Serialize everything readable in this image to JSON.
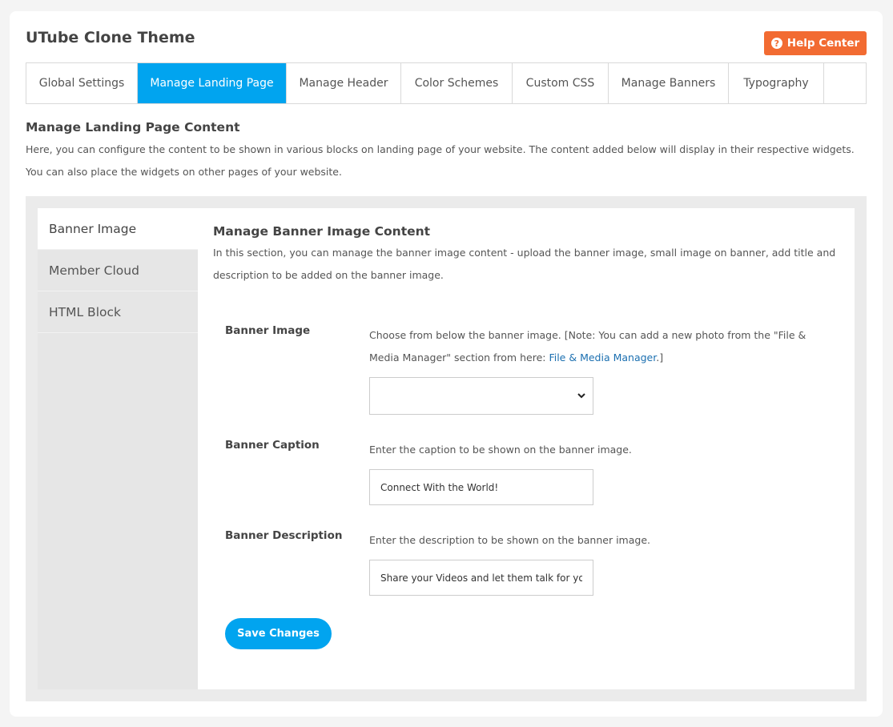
{
  "header": {
    "title": "UTube Clone Theme",
    "help_label": "Help Center",
    "help_icon": "question-circle-icon"
  },
  "tabs": [
    {
      "label": "Global Settings",
      "active": false
    },
    {
      "label": "Manage Landing Page",
      "active": true
    },
    {
      "label": "Manage Header",
      "active": false
    },
    {
      "label": "Color Schemes",
      "active": false
    },
    {
      "label": "Custom CSS",
      "active": false
    },
    {
      "label": "Manage Banners",
      "active": false
    },
    {
      "label": "Typography",
      "active": false
    }
  ],
  "section": {
    "title": "Manage Landing Page Content",
    "description": "Here, you can configure the content to be shown in various blocks on landing page of your website. The content added below will display in their respective widgets. You can also place the widgets on other pages of your website."
  },
  "sidebar": {
    "items": [
      {
        "label": "Banner Image",
        "active": true
      },
      {
        "label": "Member Cloud",
        "active": false
      },
      {
        "label": "HTML Block",
        "active": false
      }
    ]
  },
  "content": {
    "title": "Manage Banner Image Content",
    "description": "In this section, you can manage the banner image content - upload the banner image, small image on banner, add title and description to be added on the banner image.",
    "banner_image": {
      "label": "Banner Image",
      "help_prefix": "Choose from below the banner image. [Note: You can add a new photo from the \"File & Media Manager\" section from here: ",
      "help_link": "File & Media Manager",
      "help_suffix": ".]",
      "selected": ""
    },
    "banner_caption": {
      "label": "Banner Caption",
      "help": "Enter the caption to be shown on the banner image.",
      "value": "Connect With the World!"
    },
    "banner_description": {
      "label": "Banner Description",
      "help": "Enter the description to be shown on the banner image.",
      "value": "Share your Videos and let them talk for you"
    },
    "save_label": "Save Changes"
  },
  "colors": {
    "accent": "#01a4ef",
    "help_button": "#f26b32",
    "link": "#1b6fb0"
  }
}
